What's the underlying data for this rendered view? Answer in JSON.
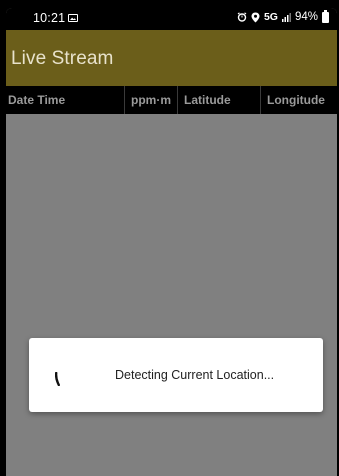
{
  "status_bar": {
    "time": "10:21",
    "network": "5G",
    "battery": "94%",
    "icons": [
      "image-icon",
      "alarm-icon",
      "location-icon",
      "signal-icon",
      "battery-icon"
    ]
  },
  "app_bar": {
    "title": "Live Stream",
    "color": "#6b5e1a"
  },
  "table": {
    "columns": [
      "Date Time",
      "ppm·m",
      "Latitude",
      "Longitude"
    ]
  },
  "dialog": {
    "message": "Detecting Current Location..."
  },
  "colors": {
    "background": "#808080",
    "header_bar": "#000000",
    "app_bar": "#6b5e1a"
  }
}
